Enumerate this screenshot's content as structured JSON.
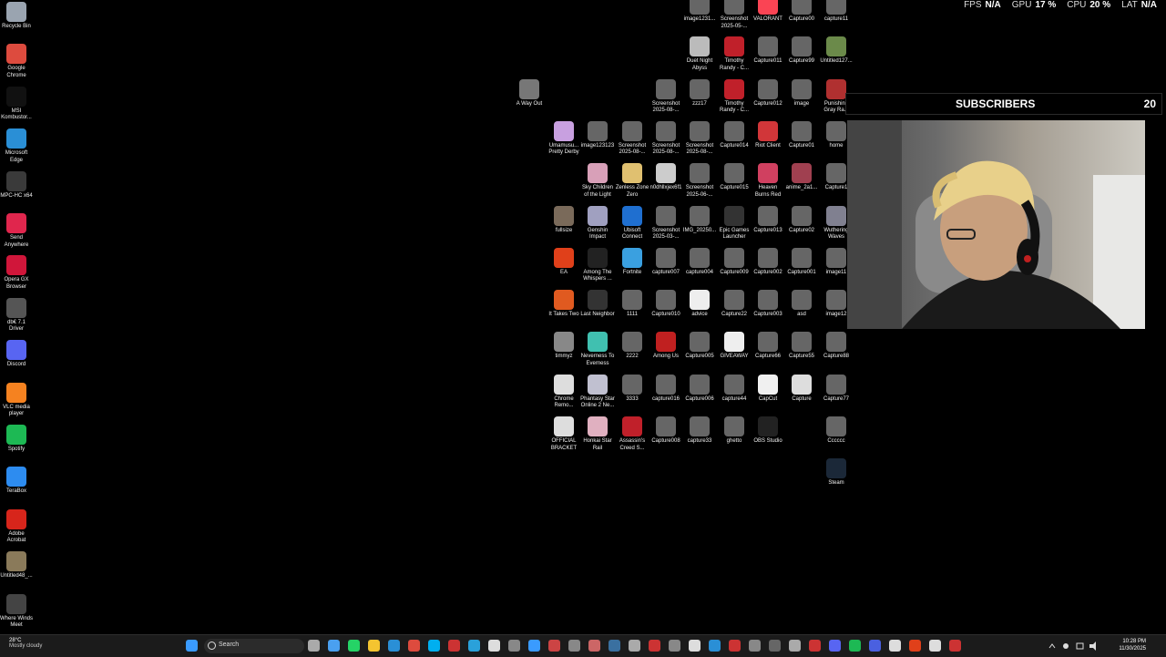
{
  "stats": [
    {
      "key": "FPS",
      "value": "N/A"
    },
    {
      "key": "GPU",
      "value": "17 %"
    },
    {
      "key": "CPU",
      "value": "20 %"
    },
    {
      "key": "LAT",
      "value": "N/A"
    }
  ],
  "subscribers": {
    "title": "SUBSCRIBERS",
    "count": "20"
  },
  "left_icons": [
    {
      "label": "Recycle Bin",
      "color": "#9aa4b0"
    },
    {
      "label": "Google Chrome",
      "color": "#dd4b3e"
    },
    {
      "label": "MSI Kombustor...",
      "color": "#111111"
    },
    {
      "label": "Microsoft Edge",
      "color": "#2a8fd6"
    },
    {
      "label": "MPC-HC x64",
      "color": "#3a3a3a"
    },
    {
      "label": "Send Anywhere",
      "color": "#e0264d"
    },
    {
      "label": "Opera GX Browser",
      "color": "#d0163a"
    },
    {
      "label": "db€ 7.1 Driver",
      "color": "#555555"
    },
    {
      "label": "Discord",
      "color": "#5865f2"
    },
    {
      "label": "VLC media player",
      "color": "#f58220"
    },
    {
      "label": "Spotify",
      "color": "#1db954"
    },
    {
      "label": "TeraBox",
      "color": "#2d8cf0"
    },
    {
      "label": "Adobe Acrobat",
      "color": "#d7251b"
    },
    {
      "label": "Untitled48_...",
      "color": "#8a7a5a"
    },
    {
      "label": "Where Winds Meet",
      "color": "#444444"
    }
  ],
  "right_icons": [
    {
      "label": "image1231...",
      "color": "#666666",
      "col": 4,
      "row": 0
    },
    {
      "label": "Screenshot 2025-05-...",
      "color": "#666666",
      "col": 5,
      "row": 0
    },
    {
      "label": "VALORANT",
      "color": "#fa4454",
      "col": 6,
      "row": 0
    },
    {
      "label": "Capture00",
      "color": "#666666",
      "col": 7,
      "row": 0
    },
    {
      "label": "capture11",
      "color": "#666666",
      "col": 8,
      "row": 0
    },
    {
      "label": "Duet Night Abyss",
      "color": "#bbbbbb",
      "col": 4,
      "row": 1
    },
    {
      "label": "Timothy Randy - C...",
      "color": "#c0202a",
      "col": 5,
      "row": 1
    },
    {
      "label": "Capture011",
      "color": "#666666",
      "col": 6,
      "row": 1
    },
    {
      "label": "Capture99",
      "color": "#666666",
      "col": 7,
      "row": 1
    },
    {
      "label": "Untitled127...",
      "color": "#6b8a4a",
      "col": 8,
      "row": 1
    },
    {
      "label": "A Way Out",
      "color": "#777777",
      "col": -1,
      "row": 2
    },
    {
      "label": "Screenshot 2025-08-...",
      "color": "#666666",
      "col": 3,
      "row": 2
    },
    {
      "label": "zzz17",
      "color": "#666666",
      "col": 4,
      "row": 2
    },
    {
      "label": "Timothy Randy - C...",
      "color": "#c0202a",
      "col": 5,
      "row": 2
    },
    {
      "label": "Capture012",
      "color": "#666666",
      "col": 6,
      "row": 2
    },
    {
      "label": "image",
      "color": "#666666",
      "col": 7,
      "row": 2
    },
    {
      "label": "Punishing Gray Ra...",
      "color": "#b03030",
      "col": 8,
      "row": 2
    },
    {
      "label": "Umamusu... Pretty Derby",
      "color": "#c8a0e0",
      "col": 0,
      "row": 3
    },
    {
      "label": "image123123",
      "color": "#666666",
      "col": 1,
      "row": 3
    },
    {
      "label": "Screenshot 2025-08-...",
      "color": "#666666",
      "col": 2,
      "row": 3
    },
    {
      "label": "Screenshot 2025-08-...",
      "color": "#666666",
      "col": 3,
      "row": 3
    },
    {
      "label": "Screenshot 2025-08-...",
      "color": "#666666",
      "col": 4,
      "row": 3
    },
    {
      "label": "Capture014",
      "color": "#666666",
      "col": 5,
      "row": 3
    },
    {
      "label": "Riot Client",
      "color": "#d13639",
      "col": 6,
      "row": 3
    },
    {
      "label": "Capture01",
      "color": "#666666",
      "col": 7,
      "row": 3
    },
    {
      "label": "home",
      "color": "#666666",
      "col": 8,
      "row": 3
    },
    {
      "label": "Sky Children of the Light",
      "color": "#d8a0b8",
      "col": 1,
      "row": 4
    },
    {
      "label": "Zenless Zone Zero",
      "color": "#e0c070",
      "col": 2,
      "row": 4
    },
    {
      "label": "n0dhllxjex6f1",
      "color": "#cccccc",
      "col": 3,
      "row": 4
    },
    {
      "label": "Screenshot 2025-06-...",
      "color": "#666666",
      "col": 4,
      "row": 4
    },
    {
      "label": "Capture015",
      "color": "#666666",
      "col": 5,
      "row": 4
    },
    {
      "label": "Heaven Burns Red",
      "color": "#d04060",
      "col": 6,
      "row": 4
    },
    {
      "label": "anime_2a1...",
      "color": "#a04050",
      "col": 7,
      "row": 4
    },
    {
      "label": "Capture1",
      "color": "#666666",
      "col": 8,
      "row": 4
    },
    {
      "label": "fullsize",
      "color": "#7a6a5a",
      "col": 0,
      "row": 5
    },
    {
      "label": "Genshin Impact",
      "color": "#a0a0c0",
      "col": 1,
      "row": 5
    },
    {
      "label": "Ubisoft Connect",
      "color": "#1f6fd0",
      "col": 2,
      "row": 5
    },
    {
      "label": "Screenshot 2025-03-...",
      "color": "#666666",
      "col": 3,
      "row": 5
    },
    {
      "label": "IMG_20250...",
      "color": "#666666",
      "col": 4,
      "row": 5
    },
    {
      "label": "Epic Games Launcher",
      "color": "#333333",
      "col": 5,
      "row": 5
    },
    {
      "label": "Capture013",
      "color": "#666666",
      "col": 6,
      "row": 5
    },
    {
      "label": "Capture02",
      "color": "#666666",
      "col": 7,
      "row": 5
    },
    {
      "label": "Wuthering Waves",
      "color": "#808090",
      "col": 8,
      "row": 5
    },
    {
      "label": "EA",
      "color": "#e0401a",
      "col": 0,
      "row": 6
    },
    {
      "label": "Among The Whispers ...",
      "color": "#222222",
      "col": 1,
      "row": 6
    },
    {
      "label": "Fortnite",
      "color": "#3aa0e0",
      "col": 2,
      "row": 6
    },
    {
      "label": "capture007",
      "color": "#666666",
      "col": 3,
      "row": 6
    },
    {
      "label": "capture004",
      "color": "#666666",
      "col": 4,
      "row": 6
    },
    {
      "label": "Capture009",
      "color": "#666666",
      "col": 5,
      "row": 6
    },
    {
      "label": "Capture002",
      "color": "#666666",
      "col": 6,
      "row": 6
    },
    {
      "label": "Capture001",
      "color": "#666666",
      "col": 7,
      "row": 6
    },
    {
      "label": "image11",
      "color": "#666666",
      "col": 8,
      "row": 6
    },
    {
      "label": "It Takes Two",
      "color": "#e05a20",
      "col": 0,
      "row": 7
    },
    {
      "label": "Last Neighbor",
      "color": "#333333",
      "col": 1,
      "row": 7
    },
    {
      "label": "1111",
      "color": "#666666",
      "col": 2,
      "row": 7
    },
    {
      "label": "Capture010",
      "color": "#666666",
      "col": 3,
      "row": 7
    },
    {
      "label": "advice",
      "color": "#eeeeee",
      "col": 4,
      "row": 7
    },
    {
      "label": "Capture22",
      "color": "#666666",
      "col": 5,
      "row": 7
    },
    {
      "label": "Capture003",
      "color": "#666666",
      "col": 6,
      "row": 7
    },
    {
      "label": "asd",
      "color": "#666666",
      "col": 7,
      "row": 7
    },
    {
      "label": "image12",
      "color": "#666666",
      "col": 8,
      "row": 7
    },
    {
      "label": "timmyz",
      "color": "#888888",
      "col": 0,
      "row": 8
    },
    {
      "label": "Neverness To Everness",
      "color": "#40c0b0",
      "col": 1,
      "row": 8
    },
    {
      "label": "2222",
      "color": "#666666",
      "col": 2,
      "row": 8
    },
    {
      "label": "Among Us",
      "color": "#c02020",
      "col": 3,
      "row": 8
    },
    {
      "label": "Capture005",
      "color": "#666666",
      "col": 4,
      "row": 8
    },
    {
      "label": "GIVEAWAY",
      "color": "#eeeeee",
      "col": 5,
      "row": 8
    },
    {
      "label": "Capture66",
      "color": "#666666",
      "col": 6,
      "row": 8
    },
    {
      "label": "Capture55",
      "color": "#666666",
      "col": 7,
      "row": 8
    },
    {
      "label": "Capture88",
      "color": "#666666",
      "col": 8,
      "row": 8
    },
    {
      "label": "Chrome Remo...",
      "color": "#dddddd",
      "col": 0,
      "row": 9
    },
    {
      "label": "Phantasy Star Online 2 Ne...",
      "color": "#c0c0d0",
      "col": 1,
      "row": 9
    },
    {
      "label": "3333",
      "color": "#666666",
      "col": 2,
      "row": 9
    },
    {
      "label": "capture016",
      "color": "#666666",
      "col": 3,
      "row": 9
    },
    {
      "label": "Capture006",
      "color": "#666666",
      "col": 4,
      "row": 9
    },
    {
      "label": "capture44",
      "color": "#666666",
      "col": 5,
      "row": 9
    },
    {
      "label": "CapCut",
      "color": "#f0f0f0",
      "col": 6,
      "row": 9
    },
    {
      "label": "Capture",
      "color": "#dddddd",
      "col": 7,
      "row": 9
    },
    {
      "label": "Capture77",
      "color": "#666666",
      "col": 8,
      "row": 9
    },
    {
      "label": "OFFICIAL BRACKET",
      "color": "#dddddd",
      "col": 0,
      "row": 10
    },
    {
      "label": "Honkai Star Rail",
      "color": "#e0b0c0",
      "col": 1,
      "row": 10
    },
    {
      "label": "Assassin's Creed S...",
      "color": "#c0202a",
      "col": 2,
      "row": 10
    },
    {
      "label": "Capture008",
      "color": "#666666",
      "col": 3,
      "row": 10
    },
    {
      "label": "capture33",
      "color": "#666666",
      "col": 4,
      "row": 10
    },
    {
      "label": "ghetto",
      "color": "#666666",
      "col": 5,
      "row": 10
    },
    {
      "label": "OBS Studio",
      "color": "#222222",
      "col": 6,
      "row": 10
    },
    {
      "label": "Cccccc",
      "color": "#666666",
      "col": 8,
      "row": 10
    },
    {
      "label": "Steam",
      "color": "#1b2838",
      "col": 8,
      "row": 11
    }
  ],
  "taskbar": {
    "weather": {
      "temp": "28°C",
      "desc": "Mostly cloudy"
    },
    "search_placeholder": "Search",
    "apps": [
      {
        "name": "start-icon",
        "color": "#3a9bff"
      },
      {
        "name": "task-view-icon",
        "color": "#aaaaaa"
      },
      {
        "name": "store-icon",
        "color": "#4aa0f0"
      },
      {
        "name": "whatsapp-icon",
        "color": "#25d366"
      },
      {
        "name": "file-explorer-icon",
        "color": "#f4c430"
      },
      {
        "name": "edge-icon",
        "color": "#2a8fd6"
      },
      {
        "name": "chrome-icon",
        "color": "#dd4b3e"
      },
      {
        "name": "skype-icon",
        "color": "#00aff0"
      },
      {
        "name": "app-icon",
        "color": "#cc3333"
      },
      {
        "name": "telegram-icon",
        "color": "#2aa1da"
      },
      {
        "name": "tiktok-icon",
        "color": "#dddddd"
      },
      {
        "name": "app-icon",
        "color": "#888888"
      },
      {
        "name": "app-icon",
        "color": "#3a9bff"
      },
      {
        "name": "app-icon",
        "color": "#cc4444"
      },
      {
        "name": "app-icon",
        "color": "#888888"
      },
      {
        "name": "app-icon",
        "color": "#cc6666"
      },
      {
        "name": "steam-icon",
        "color": "#3a70a0"
      },
      {
        "name": "app-icon",
        "color": "#aaaaaa"
      },
      {
        "name": "app-icon",
        "color": "#cc3333"
      },
      {
        "name": "app-icon",
        "color": "#888888"
      },
      {
        "name": "capcut-icon",
        "color": "#dddddd"
      },
      {
        "name": "app-icon",
        "color": "#2a8fd6"
      },
      {
        "name": "app-icon",
        "color": "#cc3333"
      },
      {
        "name": "app-icon",
        "color": "#888888"
      },
      {
        "name": "obs-icon",
        "color": "#666666"
      },
      {
        "name": "app-icon",
        "color": "#aaaaaa"
      },
      {
        "name": "app-icon",
        "color": "#cc3333"
      },
      {
        "name": "discord-icon",
        "color": "#5865f2"
      },
      {
        "name": "spotify-icon",
        "color": "#1db954"
      },
      {
        "name": "app-icon",
        "color": "#4a60e0"
      },
      {
        "name": "capcut-icon",
        "color": "#dddddd"
      },
      {
        "name": "app-icon",
        "color": "#e0401a"
      },
      {
        "name": "app-icon",
        "color": "#dddddd"
      },
      {
        "name": "app-icon",
        "color": "#cc3333"
      }
    ],
    "clock": {
      "time": "10:28 PM",
      "date": "11/30/2025"
    }
  }
}
